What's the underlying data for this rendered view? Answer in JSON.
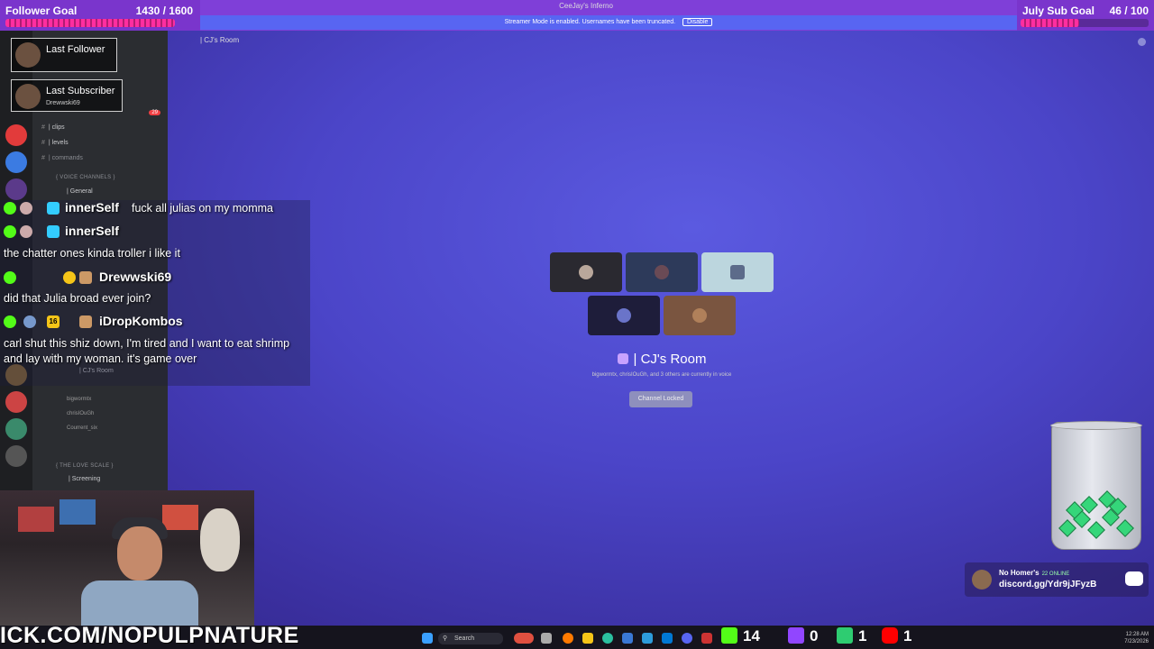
{
  "window": {
    "title": "CeeJay's Inferno"
  },
  "follower_goal": {
    "label": "Follower Goal",
    "count": "1430 / 1600",
    "progress": 0.894
  },
  "sub_goal": {
    "label": "July Sub Goal",
    "count": "46 / 100",
    "progress": 0.46
  },
  "streamer_mode": {
    "text": "Streamer Mode is enabled. Usernames have been truncated.",
    "button": "Disable"
  },
  "alerts": {
    "last_follower": "Last Follower",
    "last_subscriber": "Last Subscriber",
    "subscriber_name": "Drewwski69"
  },
  "sidebar": {
    "channels": [
      {
        "label": "| clips",
        "symbol": "#"
      },
      {
        "label": "| levels",
        "symbol": "#"
      },
      {
        "label": "| commands",
        "symbol": "#"
      }
    ],
    "voice_category": "{ VOICE CHANNELS }",
    "voice_channels": [
      {
        "label": "| General"
      },
      {
        "label": "| CJ's Room"
      }
    ],
    "room_members": [
      "bigwormtx",
      "chrisIOuGh",
      "Courrent_six"
    ],
    "love_category": "{ THE LOVE SCALE }",
    "screening": "| Screening",
    "badge": "29"
  },
  "chat": [
    {
      "user": "innerSelf",
      "message": "fuck all julias on my momma"
    },
    {
      "user": "innerSelf",
      "message": "the chatter ones kinda troller i like it"
    },
    {
      "user": "Drewwski69",
      "message": "did that Julia broad ever join?"
    },
    {
      "user": "iDropKombos",
      "badge": "16",
      "message": "carl shut this shiz down, I'm tired and I want to eat shrimp and lay with my woman. it's game over"
    }
  ],
  "voice": {
    "header": "| CJ's Room",
    "title": "| CJ's Room",
    "subtitle": "bigwormtx, chrisIOuGh, and 3 others are currently in voice",
    "locked_button": "Channel Locked"
  },
  "bottom": {
    "kick_url": "ICK.COM/NOPULPNATURE",
    "search_placeholder": "Search",
    "stats": [
      {
        "icon": "kick-icon",
        "value": "14",
        "color": "#53fc18"
      },
      {
        "icon": "twitch-icon",
        "value": "0",
        "color": "#9146ff"
      },
      {
        "icon": "kick-icon",
        "value": "1",
        "color": "#2ecc71"
      },
      {
        "icon": "youtube-icon",
        "value": "1",
        "color": "#ff0000"
      }
    ],
    "clock_time": "12:28 AM",
    "clock_date": "7/23/2026"
  },
  "discord_card": {
    "name": "No Homer's",
    "online": "22 ONLINE",
    "link": "discord.gg/Ydr9jJFyzB"
  },
  "colors": {
    "accent": "#5865f2",
    "goal_bar": "#ff2ea0",
    "background": "#4b45c8"
  }
}
